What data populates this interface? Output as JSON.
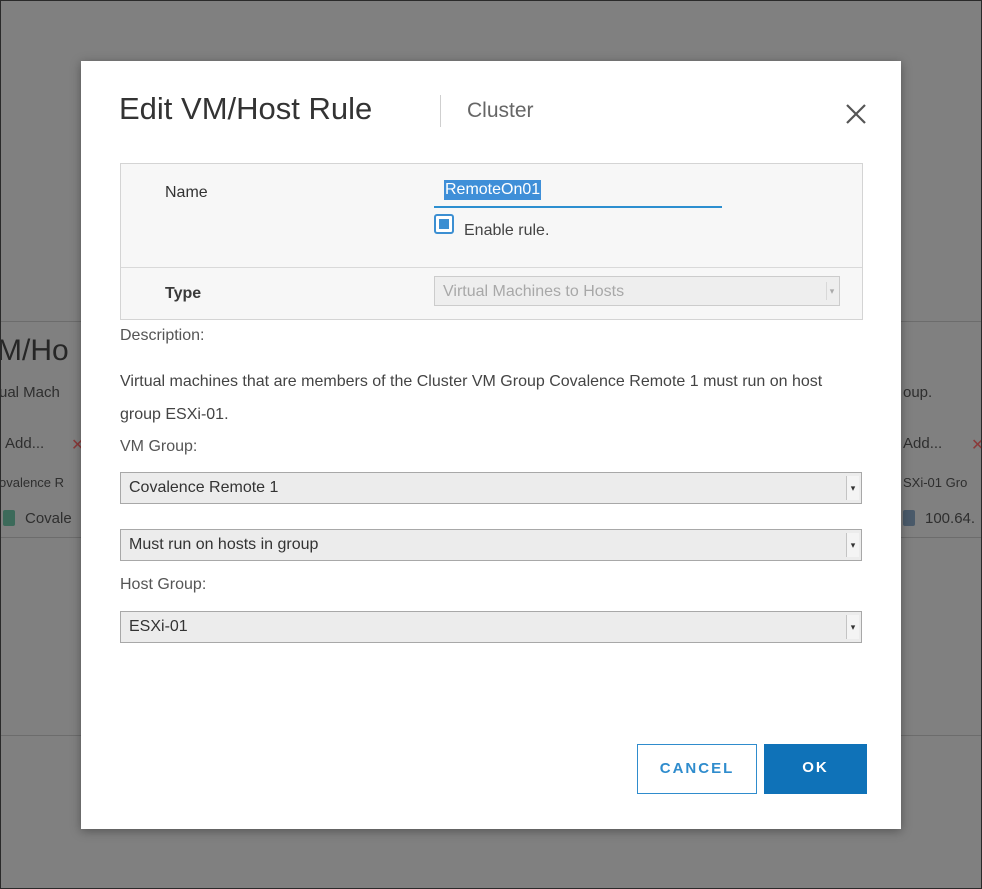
{
  "background": {
    "left_title": "M/Ho",
    "left_subtitle": "ual Mach",
    "left_add": "Add...",
    "left_col": "ovalence R",
    "left_row": "Covale",
    "right_subtitle": "oup.",
    "right_add": "Add...",
    "right_col": "SXi-01 Gro",
    "right_row": "100.64."
  },
  "dialog": {
    "title": "Edit VM/Host Rule",
    "subtitle": "Cluster",
    "close_icon": "close-icon"
  },
  "form": {
    "name_label": "Name",
    "name_value": "RemoteOn01",
    "enable_label": "Enable rule.",
    "enable_checked": true,
    "type_label": "Type",
    "type_value": "Virtual Machines to Hosts"
  },
  "description": {
    "label": "Description:",
    "text": "Virtual machines that are members of the Cluster VM Group Covalence Remote 1 must run on host group ESXi-01."
  },
  "vm_group": {
    "label": "VM Group:",
    "value": "Covalence Remote 1"
  },
  "rule": {
    "value": "Must run on hosts in group"
  },
  "host_group": {
    "label": "Host Group:",
    "value": "ESXi-01"
  },
  "buttons": {
    "cancel": "CANCEL",
    "ok": "OK"
  },
  "colors": {
    "accent": "#2f8ccd",
    "primary_button": "#0f72b8",
    "overlay": "#808080"
  }
}
